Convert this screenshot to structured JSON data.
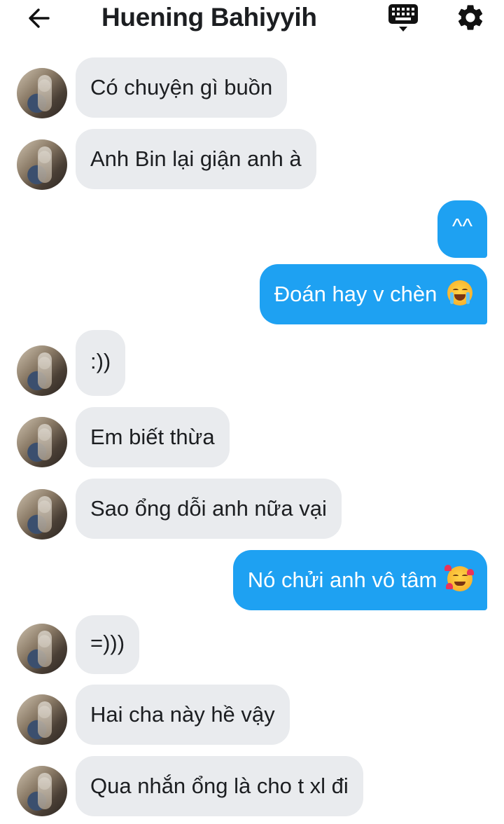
{
  "header": {
    "back_icon": "arrow-left-icon",
    "title": "Huening Bahiyyih",
    "keyboard_icon": "keyboard-icon",
    "settings_icon": "gear-icon"
  },
  "colors": {
    "incoming_bubble": "#e9ebee",
    "outgoing_bubble": "#1ea1f2",
    "outgoing_text": "#ffffff",
    "incoming_text": "#1c1e21"
  },
  "messages": [
    {
      "side": "in",
      "text": "Có chuyện gì buồn"
    },
    {
      "side": "in",
      "text": "Anh Bin lại giận anh à"
    },
    {
      "side": "out",
      "text": "^^"
    },
    {
      "side": "out",
      "text": "Đoán hay v chèn",
      "emoji": "loudly-crying-face"
    },
    {
      "side": "in",
      "text": ":))"
    },
    {
      "side": "in",
      "text": "Em biết thừa"
    },
    {
      "side": "in",
      "text": "Sao ổng dỗi anh nữa vại"
    },
    {
      "side": "out",
      "text": "Nó chửi anh vô tâm",
      "emoji": "smiling-face-with-hearts"
    },
    {
      "side": "in",
      "text": "=)))"
    },
    {
      "side": "in",
      "text": "Hai cha này hề vậy"
    },
    {
      "side": "in",
      "text": "Qua nhắn ổng là cho t xl đi"
    }
  ]
}
